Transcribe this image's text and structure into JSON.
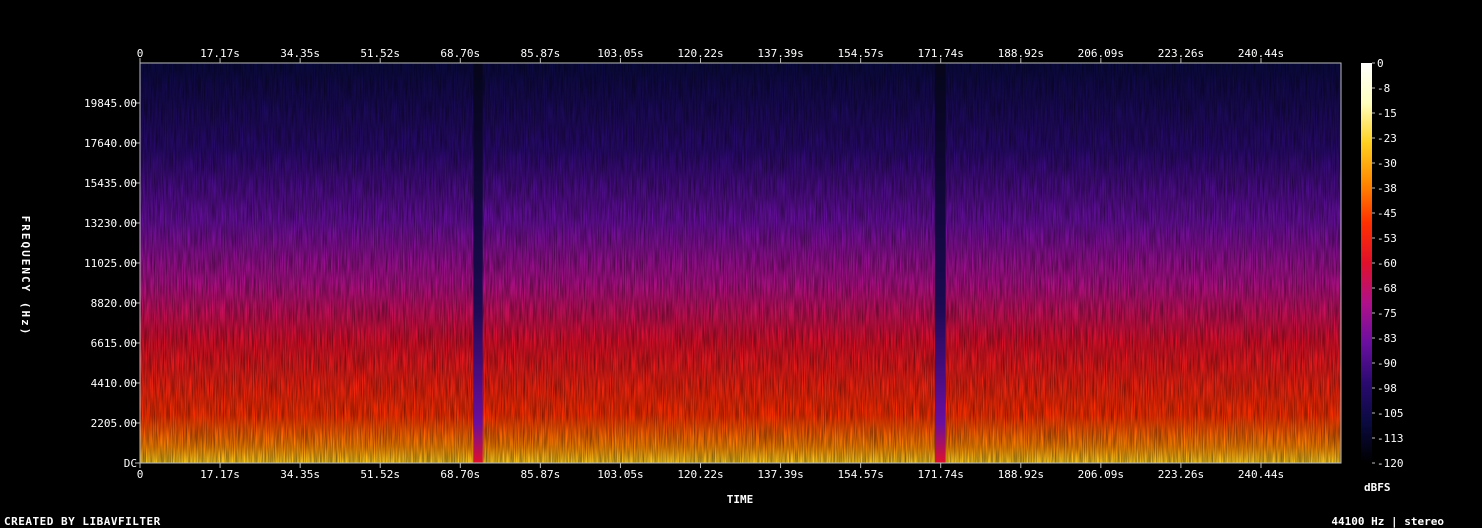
{
  "chart_data": {
    "type": "heatmap",
    "xlabel": "TIME",
    "ylabel": "FREQUENCY (Hz)",
    "x_ticks": [
      "0",
      "17.17s",
      "34.35s",
      "51.52s",
      "68.70s",
      "85.87s",
      "103.05s",
      "120.22s",
      "137.39s",
      "154.57s",
      "171.74s",
      "188.92s",
      "206.09s",
      "223.26s",
      "240.44s"
    ],
    "x_tick_values": [
      0,
      17.17,
      34.35,
      51.52,
      68.7,
      85.87,
      103.05,
      120.22,
      137.39,
      154.57,
      171.74,
      188.92,
      206.09,
      223.26,
      240.44
    ],
    "xlim": [
      0,
      257.6
    ],
    "y_ticks": [
      "DC",
      "2205.00",
      "4410.00",
      "6615.00",
      "8820.00",
      "11025.00",
      "13230.00",
      "15435.00",
      "17640.00",
      "19845.00"
    ],
    "y_tick_values": [
      0,
      2205,
      4410,
      6615,
      8820,
      11025,
      13230,
      15435,
      17640,
      19845
    ],
    "ylim": [
      0,
      22050
    ],
    "colorbar": {
      "label": "dBFS",
      "ticks": [
        "0",
        "-8",
        "-15",
        "-23",
        "-30",
        "-38",
        "-45",
        "-53",
        "-60",
        "-68",
        "-75",
        "-83",
        "-90",
        "-98",
        "-105",
        "-113",
        "-120"
      ],
      "range": [
        -120,
        0
      ],
      "colors": [
        "#000000",
        "#0a0a40",
        "#2a0a70",
        "#6a0fa0",
        "#b0108a",
        "#e0102a",
        "#ff3000",
        "#ff8800",
        "#ffd020",
        "#ffffc0",
        "#ffffff"
      ]
    },
    "quiet_segments_s": [
      [
        71.5,
        73.5
      ],
      [
        170.5,
        172.8
      ]
    ]
  },
  "footer": {
    "created_by": "CREATED BY LIBAVFILTER",
    "audio_info": "44100 Hz | stereo"
  }
}
